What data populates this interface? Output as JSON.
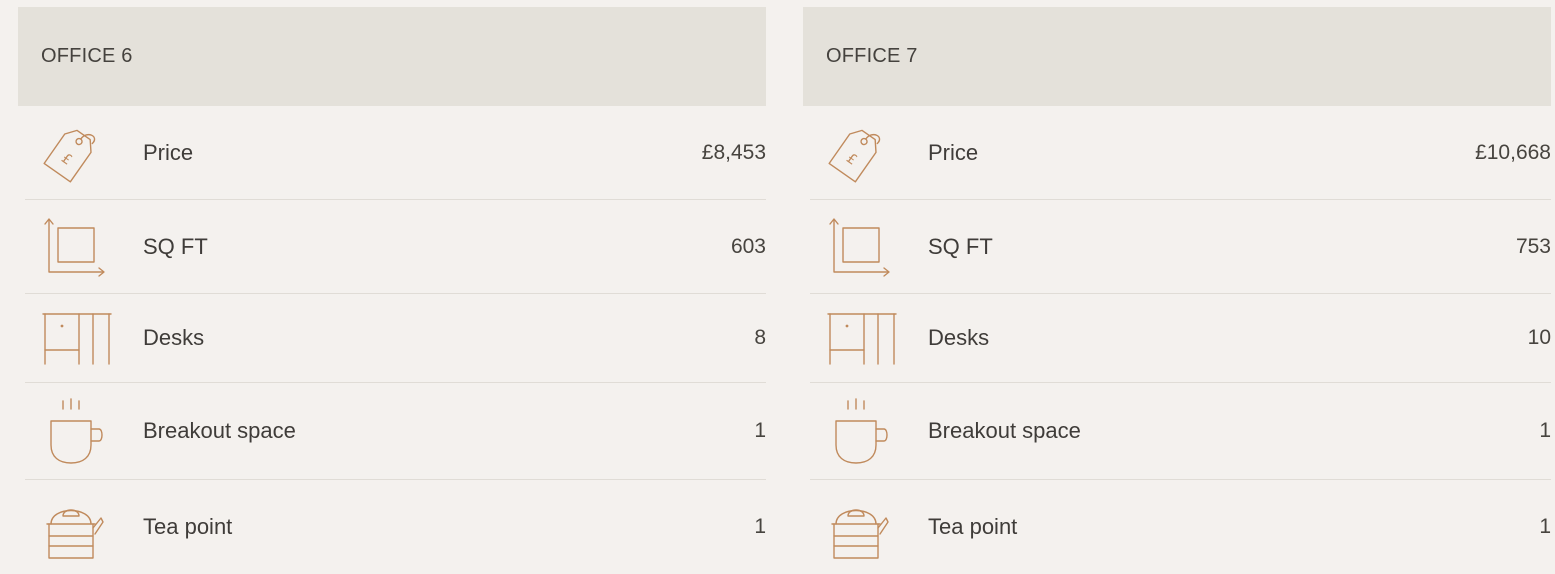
{
  "offices": [
    {
      "title": "OFFICE 6",
      "rows": [
        {
          "icon": "price-tag-icon",
          "label": "Price",
          "value": "£8,453"
        },
        {
          "icon": "floor-area-icon",
          "label": "SQ FT",
          "value": "603"
        },
        {
          "icon": "desk-icon",
          "label": "Desks",
          "value": "8"
        },
        {
          "icon": "coffee-cup-icon",
          "label": "Breakout space",
          "value": "1"
        },
        {
          "icon": "kettle-icon",
          "label": "Tea point",
          "value": "1"
        }
      ]
    },
    {
      "title": "OFFICE 7",
      "rows": [
        {
          "icon": "price-tag-icon",
          "label": "Price",
          "value": "£10,668"
        },
        {
          "icon": "floor-area-icon",
          "label": "SQ FT",
          "value": "753"
        },
        {
          "icon": "desk-icon",
          "label": "Desks",
          "value": "10"
        },
        {
          "icon": "coffee-cup-icon",
          "label": "Breakout space",
          "value": "1"
        },
        {
          "icon": "kettle-icon",
          "label": "Tea point",
          "value": "1"
        }
      ]
    }
  ],
  "colors": {
    "background": "#f4f1ee",
    "header": "#e4e1da",
    "icon": "#c08a5c",
    "divider": "#e0dcd6"
  }
}
